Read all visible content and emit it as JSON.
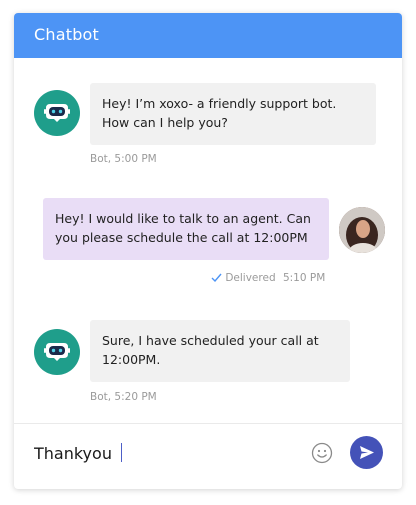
{
  "header": {
    "title": "Chatbot"
  },
  "messages": [
    {
      "sender": "bot",
      "lines": [
        "Hey! I’m xoxo- a friendly support bot.",
        "How can I help you?"
      ],
      "meta": "Bot, 5:00 PM",
      "avatar_icon": "robot-icon"
    },
    {
      "sender": "user",
      "lines": [
        "Hey! I would like to talk to an agent. Can",
        "you please schedule the call at 12:00PM"
      ],
      "status": "Delivered",
      "time": "5:10 PM",
      "status_icon": "check-icon",
      "avatar_icon": "user-avatar"
    },
    {
      "sender": "bot",
      "lines": [
        "Sure, I have scheduled your call at",
        "12:00PM."
      ],
      "meta": "Bot, 5:20 PM",
      "avatar_icon": "robot-icon"
    }
  ],
  "composer": {
    "value": "Thankyou",
    "emoji_icon": "smiley-icon",
    "send_icon": "send-icon"
  },
  "colors": {
    "header": "#4d94f5",
    "bot_avatar": "#1f9e8b",
    "bot_bubble": "#f1f1f1",
    "user_bubble": "#e9ddf6",
    "send_button": "#4452b8",
    "check": "#4d94f5"
  }
}
